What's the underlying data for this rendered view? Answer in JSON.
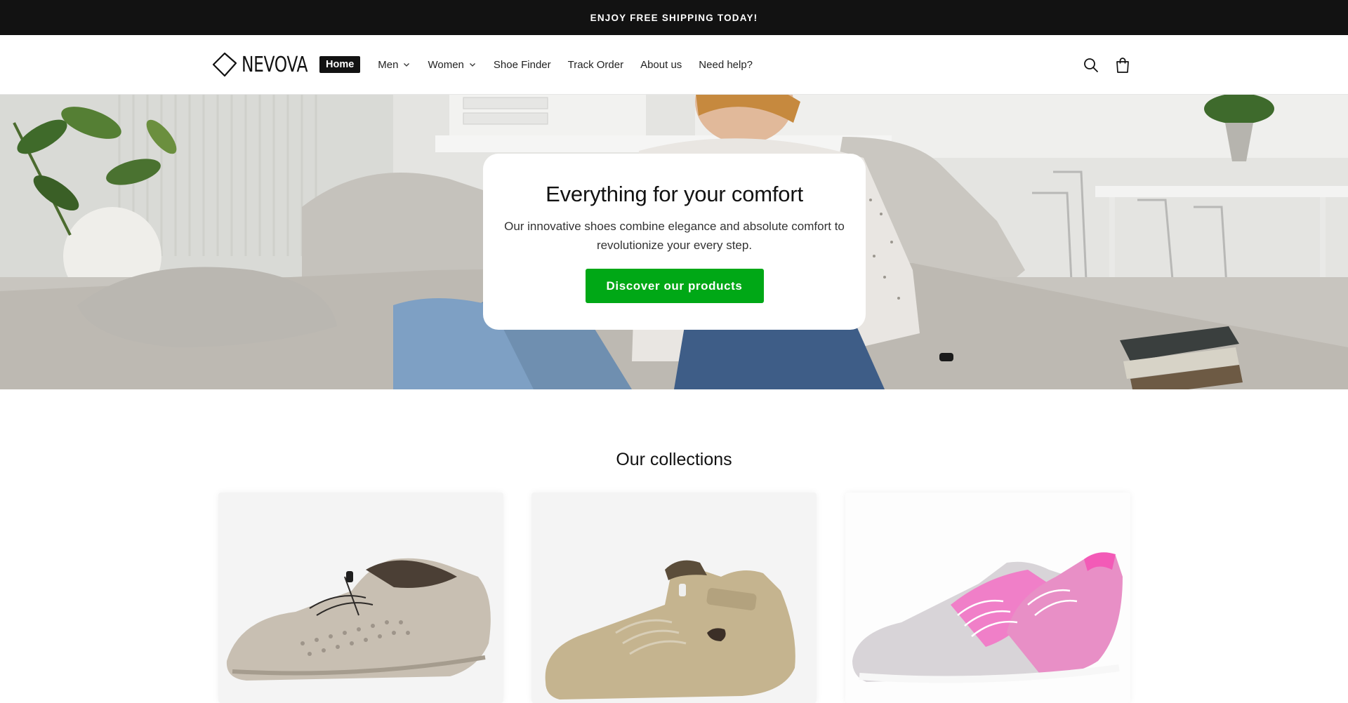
{
  "announcement": {
    "text": "ENJOY FREE SHIPPING TODAY!"
  },
  "brand": {
    "name": "NEVOVA"
  },
  "nav": {
    "items": [
      {
        "label": "Home",
        "active": true,
        "dropdown": false
      },
      {
        "label": "Men",
        "active": false,
        "dropdown": true
      },
      {
        "label": "Women",
        "active": false,
        "dropdown": true
      },
      {
        "label": "Shoe Finder",
        "active": false,
        "dropdown": false
      },
      {
        "label": "Track Order",
        "active": false,
        "dropdown": false
      },
      {
        "label": "About us",
        "active": false,
        "dropdown": false
      },
      {
        "label": "Need help?",
        "active": false,
        "dropdown": false
      }
    ]
  },
  "header_icons": [
    "search-icon",
    "cart-icon"
  ],
  "hero": {
    "title": "Everything for your comfort",
    "text": "Our innovative shoes combine elegance and absolute comfort to revolutionize your every step.",
    "button_label": "Discover our products"
  },
  "collections": {
    "title": "Our collections",
    "cards": [
      {
        "product": "beige mesh sneaker",
        "color": "#c8bfb2"
      },
      {
        "product": "khaki suede high-top",
        "color": "#c5b48f"
      },
      {
        "product": "pink knit running shoe",
        "color": "#f07fc8"
      }
    ]
  },
  "colors": {
    "accent": "#00a816",
    "topbar": "#121212"
  }
}
